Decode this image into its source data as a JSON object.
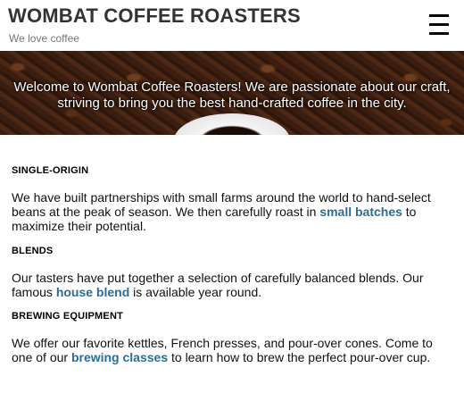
{
  "header": {
    "title": "WOMBAT COFFEE ROASTERS",
    "tagline": "We love coffee",
    "menu_icon": "hamburger-menu-icon"
  },
  "hero": {
    "text": "Welcome to Wombat Coffee Roasters! We are passionate about our craft, striving to bring you the best hand-crafted coffee in the city."
  },
  "sections": [
    {
      "heading": "SINGLE-ORIGIN",
      "text_before": "We have built partnerships with small farms around the world to hand-select beans at the peak of season. We then carefully roast in ",
      "link": "small batches",
      "text_after": " to maximize their potential."
    },
    {
      "heading": "BLENDS",
      "text_before": "Our tasters have put together a selection of carefully balanced blends. Our famous ",
      "link": "house blend",
      "text_after": " is available year round."
    },
    {
      "heading": "BREWING EQUIPMENT",
      "text_before": "We offer our favorite kettles, French presses, and pour-over cones. Come to one of our ",
      "link": "brewing classes",
      "text_after": " to learn how to brew the perfect pour-over cup."
    }
  ],
  "colors": {
    "link": "#2a6d97",
    "title": "#333333",
    "tagline": "#777777"
  }
}
